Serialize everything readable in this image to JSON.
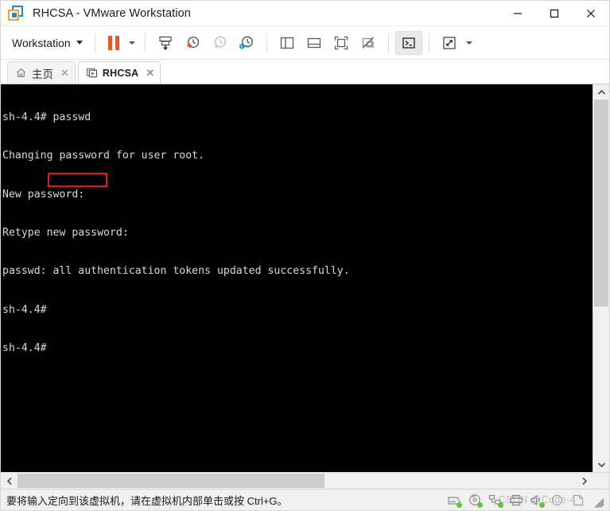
{
  "window": {
    "title": "RHCSA - VMware Workstation",
    "logo_icon": "vmware-logo-icon",
    "minimize_label": "—",
    "maximize_label": "□",
    "close_label": "✕"
  },
  "toolbar": {
    "workstation_label": "Workstation",
    "workstation_caret": "▾",
    "buttons": [
      {
        "name": "pause-vm-button",
        "icon": "pause-icon"
      },
      {
        "name": "power-dropdown-button",
        "icon": "chevron-down-icon"
      },
      {
        "name": "manage-snapshot-button",
        "icon": "snapshot-stack-icon"
      },
      {
        "name": "take-snapshot-button",
        "icon": "snapshot-add-clock-icon"
      },
      {
        "name": "revert-snapshot-button",
        "icon": "snapshot-revert-clock-icon"
      },
      {
        "name": "snapshot-manager-button",
        "icon": "snapshot-settings-clock-icon"
      },
      {
        "name": "show-sidebar-button",
        "icon": "panel-left-icon"
      },
      {
        "name": "show-thumbnail-bar-button",
        "icon": "panel-bottom-icon"
      },
      {
        "name": "fit-guest-button",
        "icon": "fit-guest-icon"
      },
      {
        "name": "autofit-off-button",
        "icon": "autofit-off-icon"
      },
      {
        "name": "console-view-button",
        "icon": "terminal-prompt-icon"
      },
      {
        "name": "full-screen-button",
        "icon": "expand-arrows-icon"
      },
      {
        "name": "full-screen-dropdown-button",
        "icon": "chevron-down-icon"
      }
    ]
  },
  "tabs": [
    {
      "label": "主页",
      "icon": "home-icon",
      "close_label": "✕",
      "active": false
    },
    {
      "label": "RHCSA",
      "icon": "vm-monitor-play-icon",
      "close_label": "✕",
      "active": true
    }
  ],
  "terminal": {
    "lines": [
      "sh-4.4# passwd",
      "Changing password for user root.",
      "New password:",
      "Retype new password:",
      "passwd: all authentication tokens updated successfully.",
      "sh-4.4#",
      "sh-4.4#"
    ],
    "highlight_text": "passwd",
    "highlight_color": "#e21b1b",
    "background_color": "#000000",
    "text_color": "#d9d9d9"
  },
  "scrollbars": {
    "vertical": {
      "up_arrow": "⌃",
      "down_arrow": "⌄",
      "thumb_percent": 58
    },
    "horizontal": {
      "left_arrow": "‹",
      "right_arrow": "›",
      "thumb_percent": 55
    }
  },
  "statusbar": {
    "message": "要将输入定向到该虚拟机，请在虚拟机内部单击或按 Ctrl+G。",
    "watermark": "CSDN @Code-4",
    "devices": [
      {
        "name": "hard-disk-icon",
        "connected": true
      },
      {
        "name": "cd-dvd-icon",
        "connected": true
      },
      {
        "name": "network-adapter-icon",
        "connected": true
      },
      {
        "name": "printer-icon",
        "connected": false
      },
      {
        "name": "sound-card-icon",
        "connected": true
      },
      {
        "name": "usb-device-icon",
        "connected": false
      },
      {
        "name": "display-icon",
        "connected": false
      }
    ],
    "grip_icon": "resize-grip-icon"
  }
}
